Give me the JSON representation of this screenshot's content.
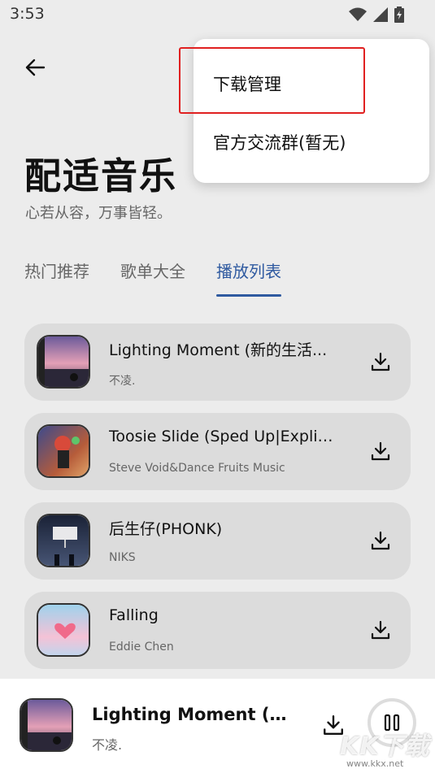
{
  "status_bar": {
    "time": "3:53"
  },
  "header": {
    "title": "配适音乐",
    "subtitle": "心若从容，万事皆轻。"
  },
  "tabs": [
    {
      "label": "热门推荐",
      "active": false
    },
    {
      "label": "歌单大全",
      "active": false
    },
    {
      "label": "播放列表",
      "active": true
    }
  ],
  "songs": [
    {
      "title": "Lighting Moment (新的生活...",
      "artist": "不凌."
    },
    {
      "title": "Toosie Slide (Sped Up|Explic...",
      "artist": "Steve Void&Dance Fruits Music"
    },
    {
      "title": "后生仔(PHONK)",
      "artist": "NIKS"
    },
    {
      "title": "Falling",
      "artist": "Eddie Chen"
    }
  ],
  "player": {
    "title": "Lighting Moment (新...",
    "artist": "不凌."
  },
  "menu": {
    "items": [
      {
        "label": "下载管理"
      },
      {
        "label": "官方交流群(暂无)"
      }
    ]
  },
  "watermark": {
    "text": "KK下载",
    "url": "www.kkx.net"
  },
  "colors": {
    "accent": "#2f5aa0",
    "highlight": "#e02020",
    "card_bg": "#dcdcdc",
    "page_bg": "#ececec"
  }
}
